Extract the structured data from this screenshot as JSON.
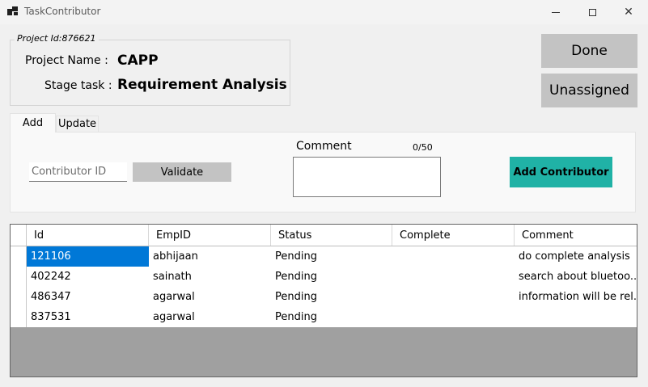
{
  "window": {
    "title": "TaskContributor",
    "min_glyph": "",
    "max_glyph": "",
    "close_glyph": "✕"
  },
  "project": {
    "legend": "Project Id:876621",
    "name_label": "Project Name :",
    "name_value": "CAPP",
    "stage_label": "Stage task :",
    "stage_value": "Requirement Analysis"
  },
  "actions": {
    "done": "Done",
    "unassigned": "Unassigned"
  },
  "tabs": [
    {
      "label": "Add",
      "active": true
    },
    {
      "label": "Update",
      "active": false
    }
  ],
  "add_panel": {
    "contributor_placeholder": "Contributor ID",
    "validate": "Validate",
    "comment_label": "Comment",
    "comment_count": "0/50",
    "add_contributor": "Add Contributor",
    "add_color": "#20b2a6"
  },
  "grid": {
    "columns": [
      "Id",
      "EmpID",
      "Status",
      "Complete",
      "Comment"
    ],
    "rows": [
      {
        "id": "121106",
        "emp": "abhijaan",
        "status": "Pending",
        "complete": "",
        "comment": "do complete analysis"
      },
      {
        "id": "402242",
        "emp": "sainath",
        "status": "Pending",
        "complete": "",
        "comment": "search about bluetoo..."
      },
      {
        "id": "486347",
        "emp": "agarwal",
        "status": "Pending",
        "complete": "",
        "comment": "information will be rel..."
      },
      {
        "id": "837531",
        "emp": "agarwal",
        "status": "Pending",
        "complete": "",
        "comment": ""
      }
    ],
    "selected_color": "#0078d7"
  }
}
